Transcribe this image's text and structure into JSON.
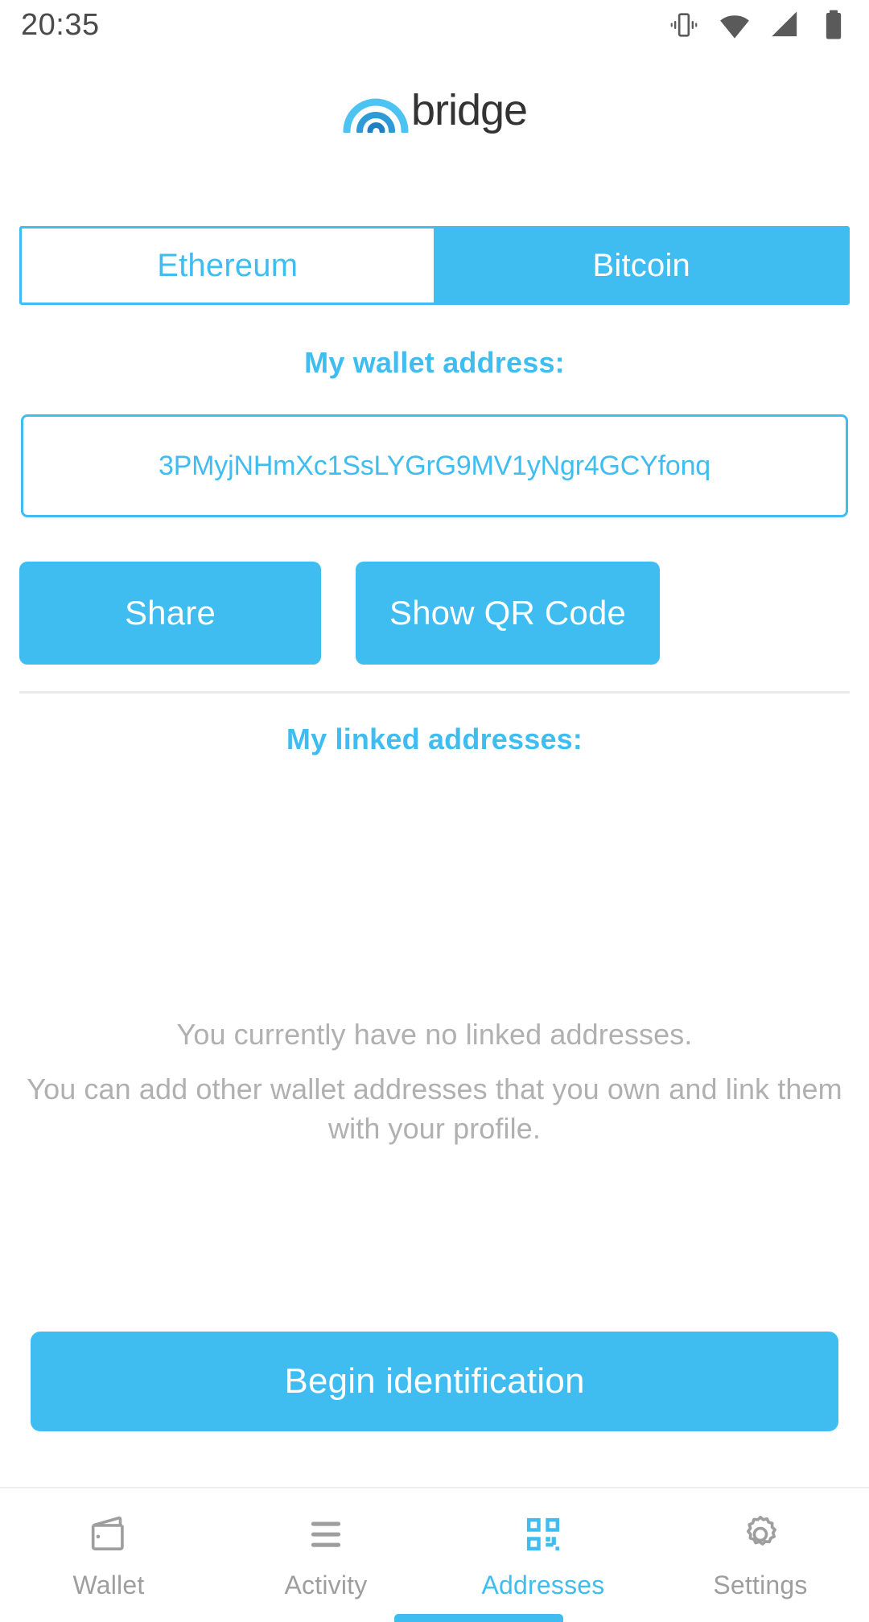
{
  "status_bar": {
    "time": "20:35",
    "icons": [
      "vibrate-icon",
      "wifi-icon",
      "signal-icon",
      "battery-icon"
    ]
  },
  "brand": {
    "logo_icon": "bridge-arc-logo",
    "name": "bridge"
  },
  "colors": {
    "accent": "#3fbdf1",
    "muted_text": "#b0b0b0",
    "nav_inactive": "#9e9e9e",
    "border": "#3fbdf1",
    "divider": "#eaeaea"
  },
  "network_tabs": {
    "selected": "Bitcoin",
    "items": [
      {
        "label": "Ethereum",
        "active": false
      },
      {
        "label": "Bitcoin",
        "active": true
      }
    ]
  },
  "wallet_section": {
    "heading": "My wallet address:",
    "address": "3PMyjNHmXc1SsLYGrG9MV1yNgr4GCYfonq",
    "share_label": "Share",
    "qr_label": "Show QR Code"
  },
  "linked_section": {
    "heading": "My linked addresses:",
    "empty_primary": "You currently have no linked addresses.",
    "empty_secondary": "You can add other wallet addresses that you own and link them with your profile.",
    "action_label": "Begin identification"
  },
  "bottom_nav": {
    "active": "Addresses",
    "items": [
      {
        "label": "Wallet",
        "icon": "wallet-icon",
        "active": false
      },
      {
        "label": "Activity",
        "icon": "list-lines-icon",
        "active": false
      },
      {
        "label": "Addresses",
        "icon": "qr-code-icon",
        "active": true
      },
      {
        "label": "Settings",
        "icon": "gear-icon",
        "active": false
      }
    ]
  }
}
